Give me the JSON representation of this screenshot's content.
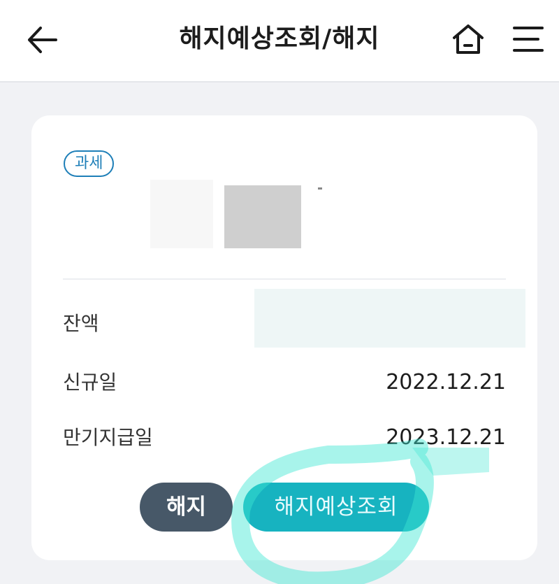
{
  "header": {
    "title": "해지예상조회/해지",
    "back_icon": "arrow-left-icon",
    "home_icon": "home-icon",
    "menu_icon": "hamburger-menu-icon"
  },
  "card": {
    "badge": "과세",
    "rows": [
      {
        "label": "잔액",
        "value": ""
      },
      {
        "label": "신규일",
        "value": "2022.12.21"
      },
      {
        "label": "만기지급일",
        "value": "2023.12.21"
      }
    ]
  },
  "buttons": {
    "cancel_label": "해지",
    "inquiry_label": "해지예상조회"
  },
  "colors": {
    "badge": "#1e7fb8",
    "cancel_button": "#475868",
    "inquiry_button": "#17b3c0",
    "scribble": "#3ee6d2"
  }
}
